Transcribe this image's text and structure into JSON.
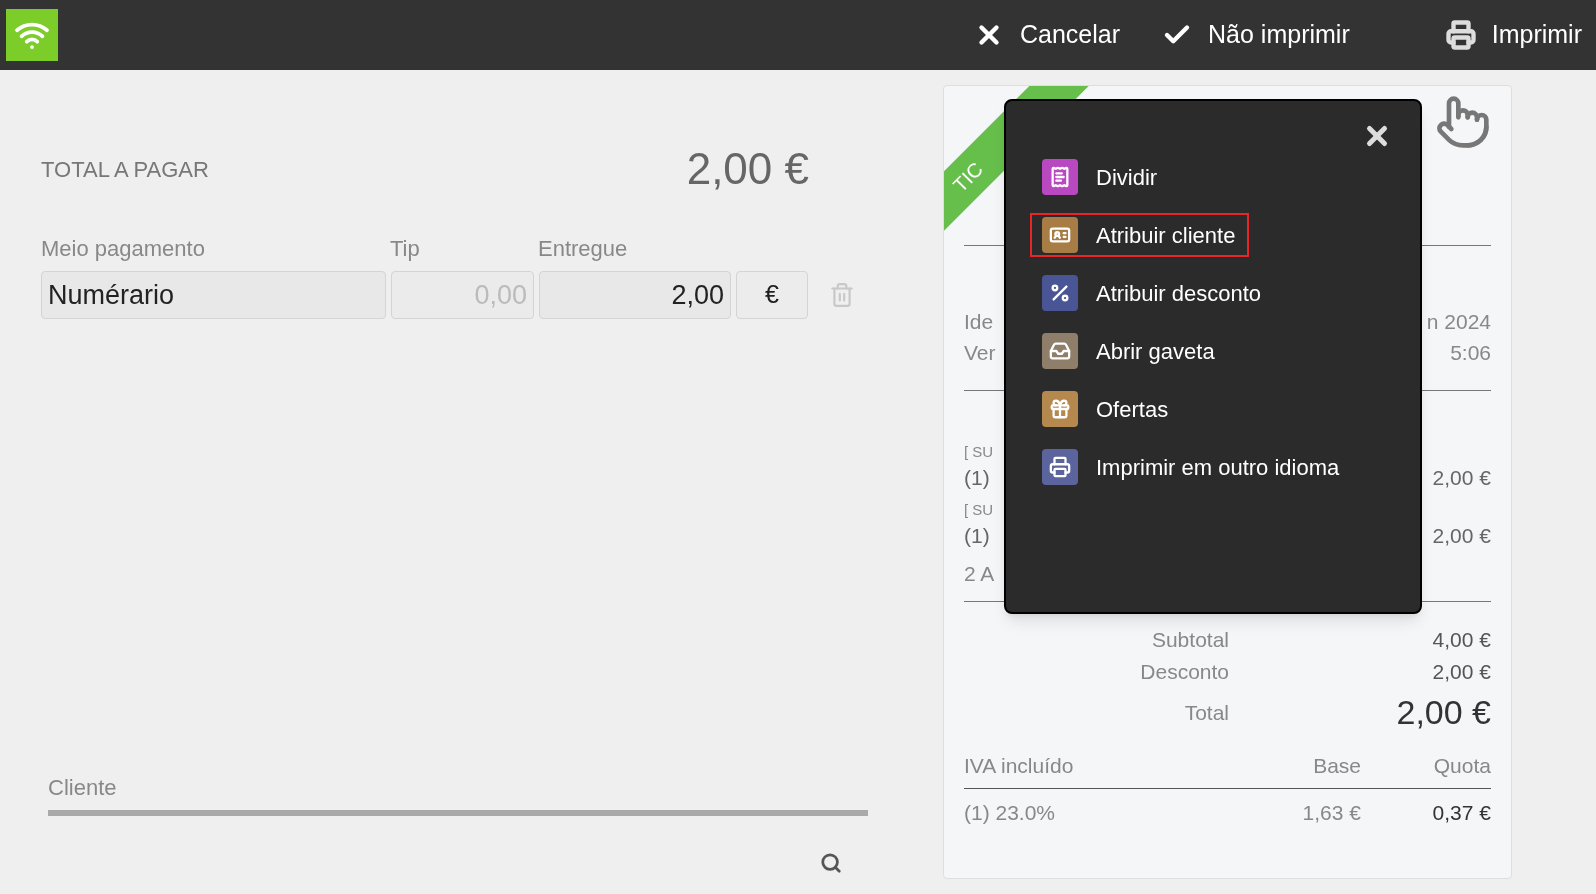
{
  "top_bar": {
    "actions": [
      {
        "kind": "cancel",
        "label": "Cancelar"
      },
      {
        "kind": "confirm",
        "label": "Não imprimir"
      },
      {
        "kind": "print",
        "label": "Imprimir"
      }
    ]
  },
  "payment": {
    "total_label": "TOTAL A PAGAR",
    "total_amount": "2,00 €",
    "columns": [
      "Meio pagamento",
      "Tip",
      "Entregue"
    ],
    "method": "Numérario",
    "tip": {
      "value": "0,00",
      "disabled": true
    },
    "delivered": "2,00",
    "currency": "€"
  },
  "client": {
    "label": "Cliente"
  },
  "receipt": {
    "ribbon": "TIC",
    "info_rows": [
      {
        "left": "Ide",
        "right": "n 2024"
      },
      {
        "left": "Ver",
        "right": "5:06"
      }
    ],
    "items": [
      {
        "line_1": "[ SU",
        "qty": "(1)",
        "amount": "2,00 €"
      },
      {
        "line_1": "[ SU",
        "qty": "(1)",
        "amount": "2,00 €"
      }
    ],
    "count": "2 A",
    "totals": [
      {
        "label": "Subtotal",
        "value": "4,00 €",
        "kind": "normal"
      },
      {
        "label": "Desconto",
        "value": "2,00 €",
        "kind": "normal"
      },
      {
        "label": "Total",
        "value": "2,00 €",
        "kind": "grand"
      }
    ],
    "tax_header": [
      "IVA incluído",
      "Base",
      "Quota"
    ],
    "tax_rows": [
      [
        "(1) 23.0%",
        "1,63 €",
        "0,37 €"
      ]
    ]
  },
  "menu": {
    "items": [
      {
        "label": "Dividir",
        "kind": "split",
        "color": "#b949c0",
        "selected": false
      },
      {
        "label": "Atribuir cliente",
        "kind": "customer",
        "color": "#a87c45",
        "selected": true
      },
      {
        "label": "Atribuir desconto",
        "kind": "discount",
        "color": "#4a5596",
        "selected": false
      },
      {
        "label": "Abrir gaveta",
        "kind": "drawer",
        "color": "#8f7e6a",
        "selected": false
      },
      {
        "label": "Ofertas",
        "kind": "gift",
        "color": "#b5884e",
        "selected": false
      },
      {
        "label": "Imprimir em outro idioma",
        "kind": "print",
        "color": "#5b649c",
        "selected": false
      }
    ]
  }
}
